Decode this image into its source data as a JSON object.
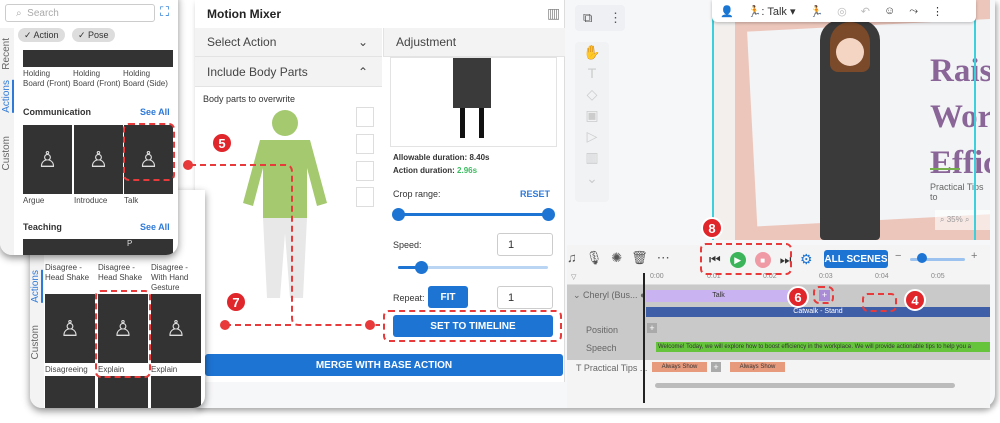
{
  "search": {
    "placeholder": "Search"
  },
  "filters": [
    "Action",
    "Pose"
  ],
  "side_tabs_a": [
    "Recent",
    "Actions",
    "Custom"
  ],
  "side_tabs_b": [
    "Actions",
    "Custom"
  ],
  "top_items": [
    "Holding Board (Front)",
    "Holding Board (Front)",
    "Holding Board (Side)"
  ],
  "communication": {
    "title": "Communication",
    "see_all": "See All",
    "items": [
      "Argue",
      "Introduce",
      "Talk"
    ]
  },
  "teaching": {
    "title": "Teaching",
    "see_all": "See All",
    "p": "P"
  },
  "panel_b": {
    "row1": [
      "Disagree - Head Shake",
      "Disagree - Head Shake",
      "Disagree - With Hand Gesture"
    ],
    "row2": [
      "Disagreeing",
      "Explain",
      "Explain"
    ]
  },
  "mixer": {
    "title": "Motion Mixer",
    "select_action": "Select Action",
    "include_body_parts": "Include Body Parts",
    "body_parts_label": "Body parts to overwrite",
    "adjustment": "Adjustment",
    "allowable_label": "Allowable duration:",
    "allowable_value": "8.40s",
    "action_label": "Action duration:",
    "action_value": "2.96s",
    "crop_label": "Crop range:",
    "reset": "RESET",
    "speed_label": "Speed:",
    "speed_value": "1",
    "speed_fraction": 0.06,
    "repeat_label": "Repeat:",
    "fit": "FIT",
    "repeat_value": "1",
    "set_timeline": "SET TO TIMELINE",
    "merge": "MERGE WITH BASE ACTION",
    "crop_range": [
      0,
      1
    ]
  },
  "canvas": {
    "action_label": ": Talk",
    "title_lines": [
      "Rais",
      "Wor",
      "Effic"
    ],
    "subtitle": "Practical Tips to",
    "zoom": "35%"
  },
  "timeline": {
    "all_scenes": "ALL SCENES",
    "ticks": [
      "0:00",
      "0:01",
      "0:02",
      "0:03",
      "0:04",
      "0:05"
    ],
    "track_name": "Cheryl (Bus...",
    "talk_clip": "Talk",
    "base_clip": "Catwalk - Stand",
    "position": "Position",
    "speech": "Speech",
    "speech_text": "Welcome! Today, we will explore how to boost efficiency in the workplace. We will provide actionable tips to help you a",
    "text_track": "Practical Tips ...",
    "always_show": "Always Show"
  },
  "badges": [
    "5",
    "6",
    "4",
    "7",
    "8"
  ],
  "colors": {
    "accent": "#1d74d3",
    "annotation": "#e0262b",
    "body_green": "#a4c96f",
    "talk_clip": "#c9b3f0",
    "base_clip": "#3f5ea8",
    "speech_clip": "#66c43c",
    "text_clip": "#e89a7c",
    "action_duration": "#3dbb60"
  }
}
